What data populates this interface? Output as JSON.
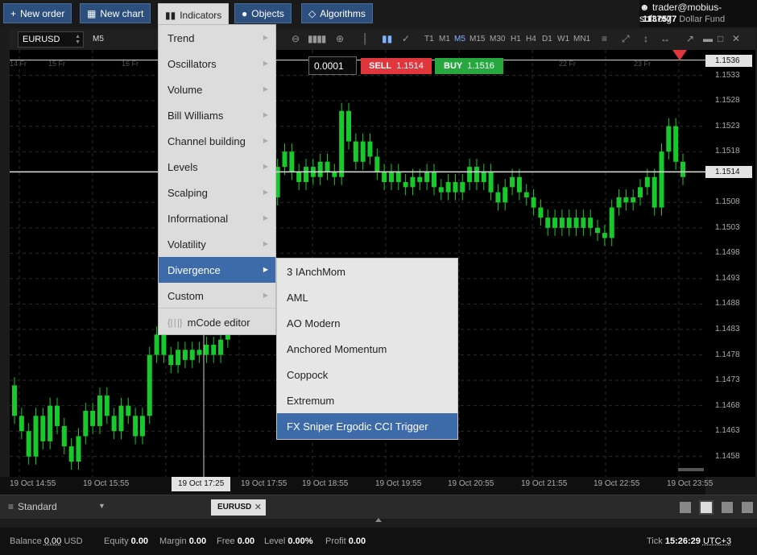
{
  "toolbar": {
    "new_order": "New order",
    "new_chart": "New chart",
    "indicators": "Indicators",
    "objects": "Objects",
    "algorithms": "Algorithms"
  },
  "account": {
    "email": "trader@mobius-soft.org",
    "number": "1137577",
    "name": "Dollar Fund"
  },
  "chart_toolbar": {
    "symbol": "EURUSD",
    "timeframe": "M5",
    "timeframes": [
      "T1",
      "M1",
      "M5",
      "M15",
      "M30",
      "H1",
      "H4",
      "D1",
      "W1",
      "MN1"
    ],
    "selected_timeframe": "M5"
  },
  "trade": {
    "lot": "0.0001",
    "sell_label": "SELL",
    "sell_price": "1.1514",
    "buy_label": "BUY",
    "buy_price": "1.1516"
  },
  "indicators_menu": {
    "items": [
      "Trend",
      "Oscillators",
      "Volume",
      "Bill Williams",
      "Channel building",
      "Levels",
      "Scalping",
      "Informational",
      "Volatility",
      "Divergence",
      "Custom"
    ],
    "selected": "Divergence",
    "mcode_editor": "mCode editor"
  },
  "divergence_submenu": {
    "items": [
      "3 IAnchMom",
      "AML",
      "AO Modern",
      "Anchored Momentum",
      "Coppock",
      "Extremum",
      "FX Sniper Ergodic CCI Trigger"
    ],
    "selected": "FX Sniper Ergodic CCI Trigger"
  },
  "price_axis": {
    "labels": [
      "1.1533",
      "1.1528",
      "1.1523",
      "1.1518",
      "1.1508",
      "1.1503",
      "1.1498",
      "1.1493",
      "1.1488",
      "1.1483",
      "1.1478",
      "1.1473",
      "1.1468",
      "1.1463",
      "1.1458"
    ],
    "ask_tag": "1.1536",
    "bid_tag": "1.1514"
  },
  "time_axis": {
    "labels": [
      "19 Oct 14:55",
      "19 Oct 15:55",
      "19 Oct 17:55",
      "19 Oct 18:55",
      "19 Oct 19:55",
      "19 Oct 20:55",
      "19 Oct 21:55",
      "19 Oct 22:55",
      "19 Oct 23:55"
    ],
    "cursor_tag": "19 Oct 17:25",
    "day_labels": [
      "14 Fr",
      "15 Fr",
      "16 Fr",
      "22 Fr",
      "23 Fr"
    ]
  },
  "chart_data": {
    "type": "candlestick",
    "symbol": "EURUSD",
    "timeframe": "M5",
    "ylim": [
      1.1454,
      1.1538
    ],
    "ask_line": 1.1536,
    "bid_line": 1.1514,
    "candles": [
      {
        "o": 1.1472,
        "c": 1.1466
      },
      {
        "o": 1.1466,
        "c": 1.1463
      },
      {
        "o": 1.1463,
        "c": 1.1458
      },
      {
        "o": 1.1458,
        "c": 1.1466
      },
      {
        "o": 1.1466,
        "c": 1.1461
      },
      {
        "o": 1.1461,
        "c": 1.1468
      },
      {
        "o": 1.1468,
        "c": 1.1464
      },
      {
        "o": 1.1464,
        "c": 1.146
      },
      {
        "o": 1.146,
        "c": 1.1457
      },
      {
        "o": 1.1457,
        "c": 1.1462
      },
      {
        "o": 1.1462,
        "c": 1.1467
      },
      {
        "o": 1.1467,
        "c": 1.1464
      },
      {
        "o": 1.1464,
        "c": 1.147
      },
      {
        "o": 1.147,
        "c": 1.1466
      },
      {
        "o": 1.1466,
        "c": 1.1463
      },
      {
        "o": 1.1463,
        "c": 1.1468
      },
      {
        "o": 1.1468,
        "c": 1.1466
      },
      {
        "o": 1.1466,
        "c": 1.1462
      },
      {
        "o": 1.1462,
        "c": 1.1466
      },
      {
        "o": 1.1466,
        "c": 1.1478
      },
      {
        "o": 1.1478,
        "c": 1.1482
      },
      {
        "o": 1.1482,
        "c": 1.1478
      },
      {
        "o": 1.1478,
        "c": 1.1476
      },
      {
        "o": 1.1476,
        "c": 1.1479
      },
      {
        "o": 1.1479,
        "c": 1.1477
      },
      {
        "o": 1.1477,
        "c": 1.1479
      },
      {
        "o": 1.1479,
        "c": 1.1478
      },
      {
        "o": 1.1478,
        "c": 1.148
      },
      {
        "o": 1.148,
        "c": 1.1478
      },
      {
        "o": 1.1478,
        "c": 1.1481
      },
      {
        "o": 1.1481,
        "c": 1.1485
      },
      {
        "o": 1.1485,
        "c": 1.149
      },
      {
        "o": 1.149,
        "c": 1.1496
      },
      {
        "o": 1.1496,
        "c": 1.1502
      },
      {
        "o": 1.1502,
        "c": 1.1507
      },
      {
        "o": 1.1507,
        "c": 1.1512
      },
      {
        "o": 1.1512,
        "c": 1.1509
      },
      {
        "o": 1.1509,
        "c": 1.1515
      },
      {
        "o": 1.1515,
        "c": 1.1518
      },
      {
        "o": 1.1518,
        "c": 1.1514
      },
      {
        "o": 1.1514,
        "c": 1.1512
      },
      {
        "o": 1.1512,
        "c": 1.1515
      },
      {
        "o": 1.1515,
        "c": 1.1513
      },
      {
        "o": 1.1513,
        "c": 1.1516
      },
      {
        "o": 1.1516,
        "c": 1.1514
      },
      {
        "o": 1.1514,
        "c": 1.1513
      },
      {
        "o": 1.1513,
        "c": 1.1526
      },
      {
        "o": 1.1526,
        "c": 1.152
      },
      {
        "o": 1.152,
        "c": 1.1516
      },
      {
        "o": 1.1516,
        "c": 1.152
      },
      {
        "o": 1.152,
        "c": 1.1517
      },
      {
        "o": 1.1517,
        "c": 1.1514
      },
      {
        "o": 1.1514,
        "c": 1.1512
      },
      {
        "o": 1.1512,
        "c": 1.1514
      },
      {
        "o": 1.1514,
        "c": 1.1512
      },
      {
        "o": 1.1512,
        "c": 1.1511
      },
      {
        "o": 1.1511,
        "c": 1.1513
      },
      {
        "o": 1.1513,
        "c": 1.1512
      },
      {
        "o": 1.1512,
        "c": 1.1514
      },
      {
        "o": 1.1514,
        "c": 1.1511
      },
      {
        "o": 1.1511,
        "c": 1.151
      },
      {
        "o": 1.151,
        "c": 1.1512
      },
      {
        "o": 1.1512,
        "c": 1.151
      },
      {
        "o": 1.151,
        "c": 1.1512
      },
      {
        "o": 1.1512,
        "c": 1.1515
      },
      {
        "o": 1.1515,
        "c": 1.1512
      },
      {
        "o": 1.1512,
        "c": 1.1514
      },
      {
        "o": 1.1514,
        "c": 1.151
      },
      {
        "o": 1.151,
        "c": 1.1508
      },
      {
        "o": 1.1508,
        "c": 1.1511
      },
      {
        "o": 1.1511,
        "c": 1.1513
      },
      {
        "o": 1.1513,
        "c": 1.151
      },
      {
        "o": 1.151,
        "c": 1.1509
      },
      {
        "o": 1.1509,
        "c": 1.1507
      },
      {
        "o": 1.1507,
        "c": 1.1505
      },
      {
        "o": 1.1505,
        "c": 1.1503
      },
      {
        "o": 1.1503,
        "c": 1.1505
      },
      {
        "o": 1.1505,
        "c": 1.1503
      },
      {
        "o": 1.1503,
        "c": 1.1505
      },
      {
        "o": 1.1505,
        "c": 1.1503
      },
      {
        "o": 1.1503,
        "c": 1.1505
      },
      {
        "o": 1.1505,
        "c": 1.1503
      },
      {
        "o": 1.1503,
        "c": 1.1502
      },
      {
        "o": 1.1502,
        "c": 1.1501
      },
      {
        "o": 1.1501,
        "c": 1.1507
      },
      {
        "o": 1.1507,
        "c": 1.1509
      },
      {
        "o": 1.1509,
        "c": 1.1508
      },
      {
        "o": 1.1508,
        "c": 1.1509
      },
      {
        "o": 1.1509,
        "c": 1.1511
      },
      {
        "o": 1.1511,
        "c": 1.1513
      },
      {
        "o": 1.1513,
        "c": 1.1507
      },
      {
        "o": 1.1507,
        "c": 1.1518
      },
      {
        "o": 1.1518,
        "c": 1.1523
      },
      {
        "o": 1.1523,
        "c": 1.1516
      },
      {
        "o": 1.1516,
        "c": 1.1513
      }
    ]
  },
  "bottom_bar": {
    "layout": "Standard",
    "tab": "EURUSD"
  },
  "status": {
    "balance_label": "Balance",
    "balance": "0.00",
    "currency": "USD",
    "equity_label": "Equity",
    "equity": "0.00",
    "margin_label": "Margin",
    "margin": "0.00",
    "free_label": "Free",
    "free": "0.00",
    "level_label": "Level",
    "level": "0.00%",
    "profit_label": "Profit",
    "profit": "0.00",
    "tick_label": "Tick",
    "time": "15:26:29",
    "timezone": "UTC+3"
  }
}
